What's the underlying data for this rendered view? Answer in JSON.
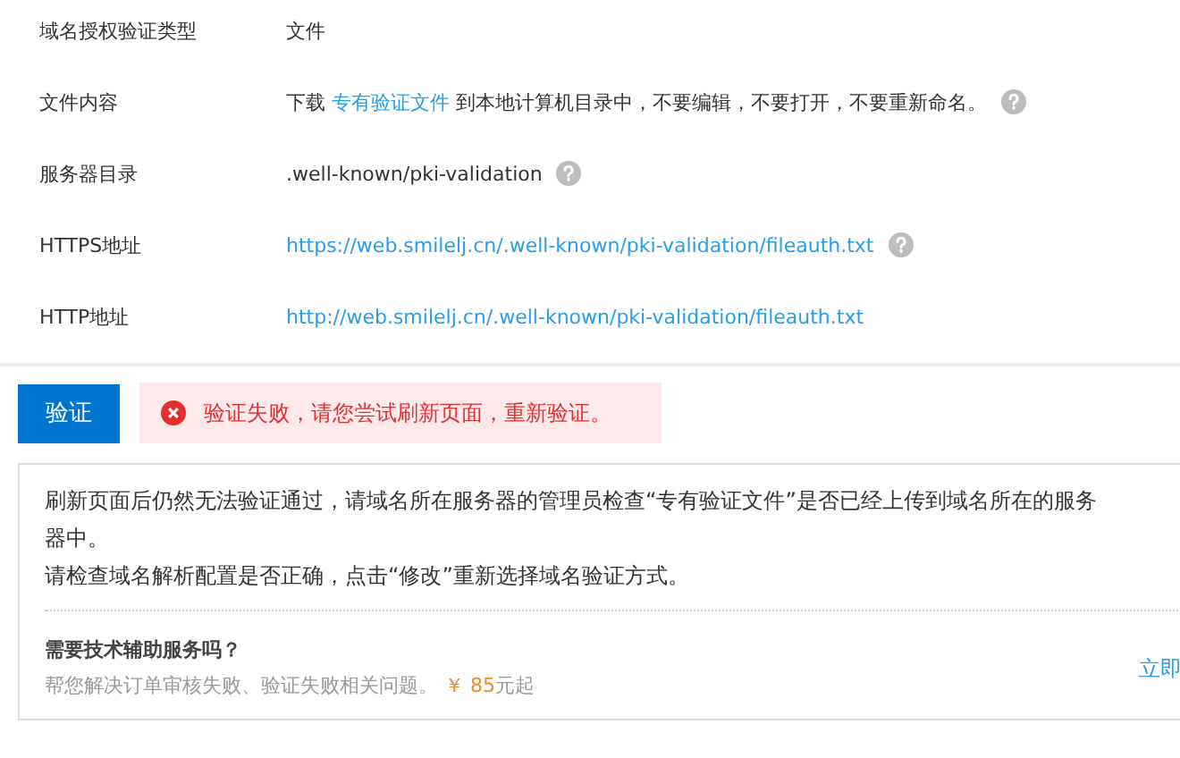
{
  "fields": [
    {
      "label": "域名授权验证类型",
      "kind": "text",
      "value": "文件",
      "help": false
    },
    {
      "label": "文件内容",
      "kind": "sentence",
      "prefix": "下载",
      "link": "专有验证文件",
      "suffix": "到本地计算机目录中，不要编辑，不要打开，不要重新命名。",
      "help": true
    },
    {
      "label": "服务器目录",
      "kind": "text",
      "value": ".well-known/pki-validation",
      "help": true
    },
    {
      "label": "HTTPS地址",
      "kind": "link",
      "value": "https://web.smilelj.cn/.well-known/pki-validation/fileauth.txt",
      "help": true
    },
    {
      "label": "HTTP地址",
      "kind": "link",
      "value": "http://web.smilelj.cn/.well-known/pki-validation/fileauth.txt",
      "help": false
    }
  ],
  "verify_button": "验证",
  "error": {
    "text": "验证失败，请您尝试刷新页面，重新验证。"
  },
  "notice": {
    "lines": [
      "刷新页面后仍然无法验证通过，请域名所在服务器的管理员检查“专有验证文件”是否已经上传到域名所在的服务器中。",
      "请检查域名解析配置是否正确，点击“修改”重新选择域名验证方式。"
    ],
    "service_title": "需要技术辅助服务吗？",
    "service_text": "帮您解决订单审核失败、验证失败相关问题。",
    "price": "￥ 85",
    "price_suffix": "元起",
    "consult_link": "立即"
  }
}
